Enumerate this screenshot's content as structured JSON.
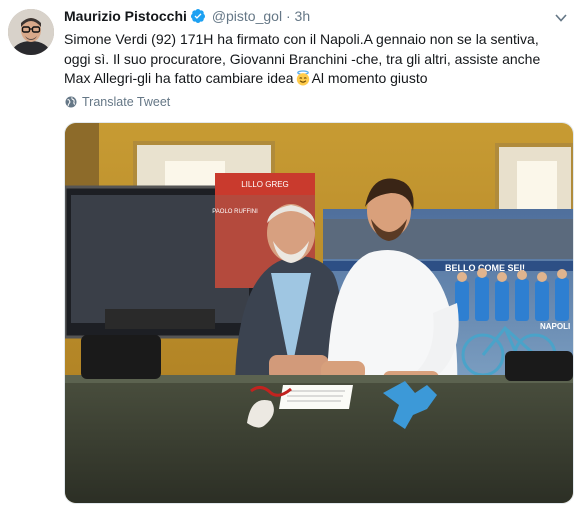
{
  "tweet": {
    "author_name": "Maurizio Pistocchi",
    "handle": "@pisto_gol",
    "separator": "·",
    "time": "3h",
    "text_part1": "Simone Verdi (92) 171H ha firmato con il Napoli.A gennaio non se la sentiva, oggi sì. Il suo procuratore, Giovanni Branchini -che, tra gli altri, assiste anche Max Allegri-gli ha fatto cambiare idea",
    "text_part2": "Al momento giusto",
    "emoji": "smiling-face-with-halo-emoji",
    "translate_label": "Translate Tweet"
  },
  "media": {
    "poster_text_top": "LILLO GREG",
    "poster_text_names": "PAOLO RUFFINI",
    "banner_text": "BELLO COME SEI!",
    "jersey_text": "NAPOLI"
  },
  "colors": {
    "accent": "#1da1f2",
    "secondary_text": "#657786",
    "primary_text": "#14171a"
  }
}
